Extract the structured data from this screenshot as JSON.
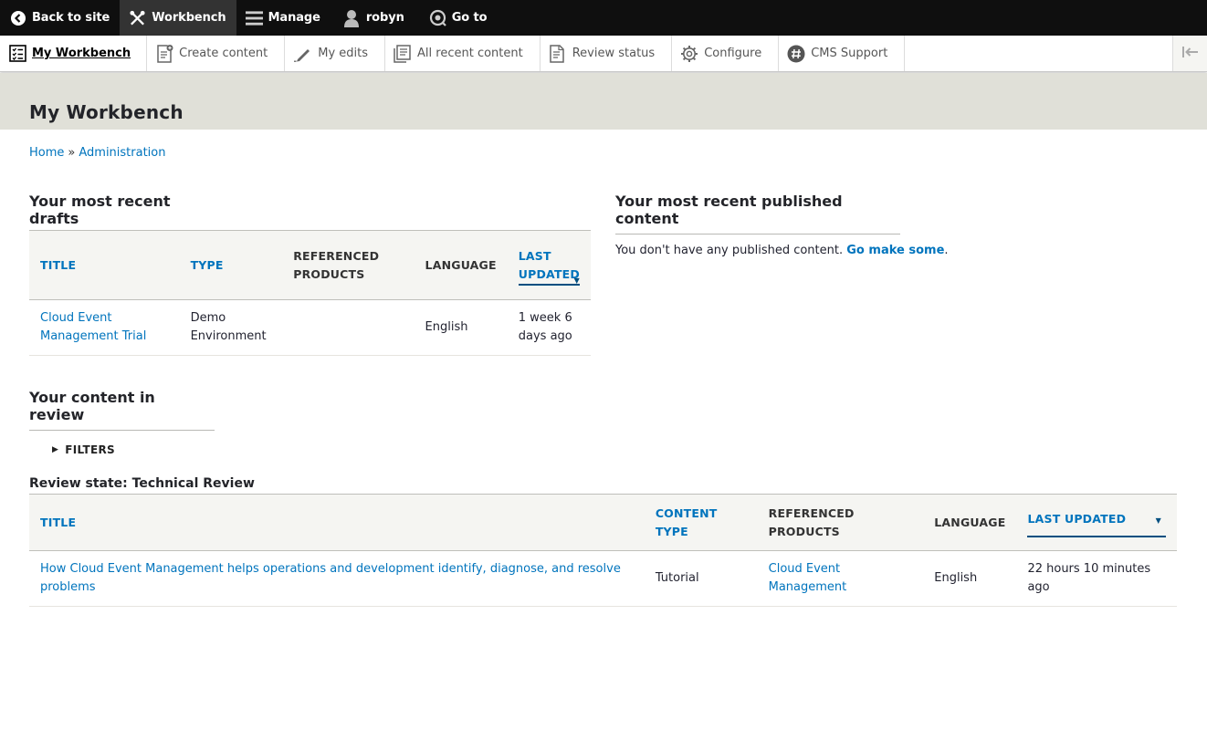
{
  "toolbar": {
    "back": "Back to site",
    "workbench": "Workbench",
    "manage": "Manage",
    "user": "robyn",
    "goto": "Go to"
  },
  "tray": {
    "my_workbench": "My Workbench",
    "create_content": "Create content",
    "my_edits": "My edits",
    "all_recent": "All recent content",
    "review_status": "Review status",
    "configure": "Configure",
    "cms_support": "CMS Support"
  },
  "page": {
    "title": "My Workbench"
  },
  "breadcrumb": {
    "home": "Home",
    "sep": "»",
    "admin": "Administration"
  },
  "drafts": {
    "heading": "Your most recent drafts",
    "headers": {
      "title": "TITLE",
      "type": "TYPE",
      "ref1": "REFERENCED",
      "ref2": "PRODUCTS",
      "language": "LANGUAGE",
      "updated1": "LAST",
      "updated2": "UPDATED"
    },
    "rows": [
      {
        "title1": "Cloud Event",
        "title2": "Management Trial",
        "type1": "Demo",
        "type2": "Environment",
        "products": "",
        "language": "English",
        "updated1": "1 week 6",
        "updated2": "days ago"
      }
    ]
  },
  "published": {
    "heading": "Your most recent published content",
    "message": "You don't have any published content.",
    "link": "Go make some",
    "period": "."
  },
  "review": {
    "heading": "Your content in review",
    "filters": "FILTERS",
    "state": "Review state: Technical Review",
    "headers": {
      "title": "TITLE",
      "ctype1": "CONTENT",
      "ctype2": "TYPE",
      "ref1": "REFERENCED",
      "ref2": "PRODUCTS",
      "language": "LANGUAGE",
      "updated": "LAST UPDATED"
    },
    "rows": [
      {
        "title1": "How Cloud Event Management helps operations and development identify, diagnose, and resolve",
        "title2": "problems",
        "type": "Tutorial",
        "products1": "Cloud Event",
        "products2": "Management",
        "language": "English",
        "updated1": "22 hours 10 minutes",
        "updated2": "ago"
      }
    ]
  }
}
